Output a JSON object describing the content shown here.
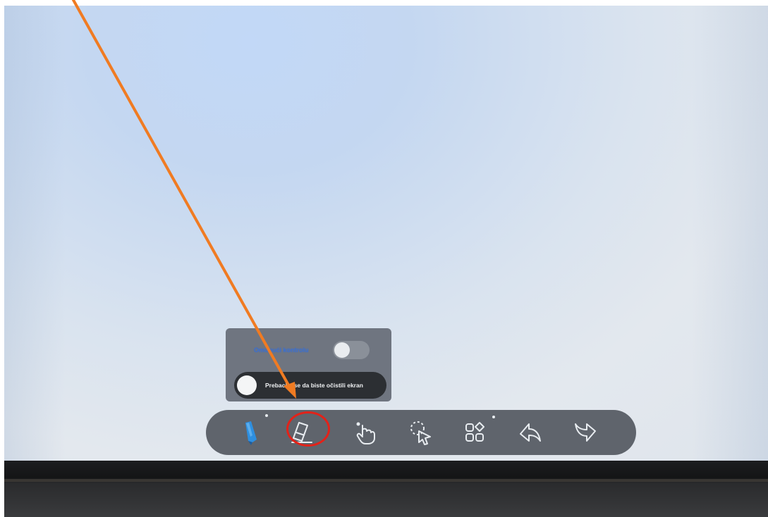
{
  "popup": {
    "toggle_label": "Omogući kontrolu",
    "switch_label": "Prebacite se da biste očistili ekran",
    "toggle_state": "off"
  },
  "toolbar": {
    "tools": [
      {
        "name": "pen",
        "icon": "pen-icon"
      },
      {
        "name": "eraser",
        "icon": "eraser-icon",
        "highlighted": true
      },
      {
        "name": "touch",
        "icon": "hand-pointer-icon"
      },
      {
        "name": "select",
        "icon": "lasso-select-icon"
      },
      {
        "name": "apps",
        "icon": "apps-grid-icon"
      },
      {
        "name": "undo",
        "icon": "undo-arrow-icon"
      },
      {
        "name": "redo",
        "icon": "redo-arrow-icon"
      }
    ]
  },
  "colors": {
    "toolbar_bg": "#5f646c",
    "popup_bg": "#6f7580",
    "annotation_arrow": "#f07b22",
    "annotation_circle": "#e32219",
    "pen_blue": "#2e8fe0"
  }
}
